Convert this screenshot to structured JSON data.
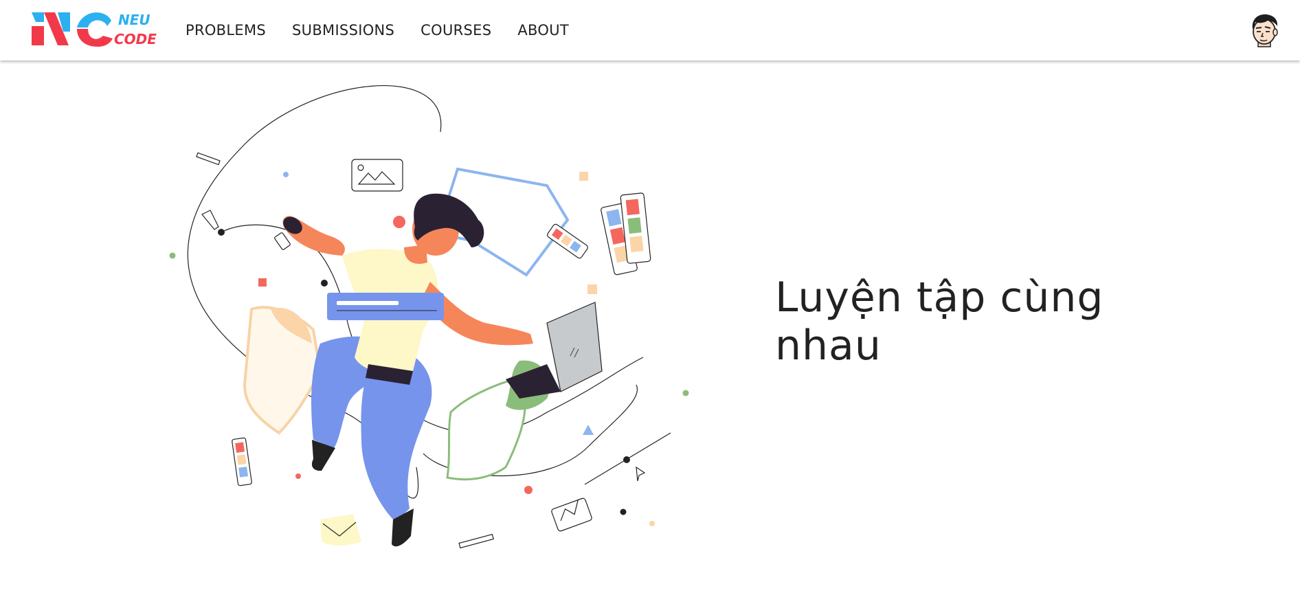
{
  "brand": {
    "mark": "NC",
    "word_top": "NEU",
    "word_bottom": "CODE",
    "color_red": "#f2394a",
    "color_blue": "#2bb0f0"
  },
  "nav": {
    "items": [
      {
        "label": "PROBLEMS"
      },
      {
        "label": "SUBMISSIONS"
      },
      {
        "label": "COURSES"
      },
      {
        "label": "ABOUT"
      }
    ]
  },
  "user": {
    "avatar_icon": "user-avatar-icon"
  },
  "hero": {
    "title": "Luyện tập cùng nhau",
    "illustration_icon": "coding-person-illustration"
  }
}
